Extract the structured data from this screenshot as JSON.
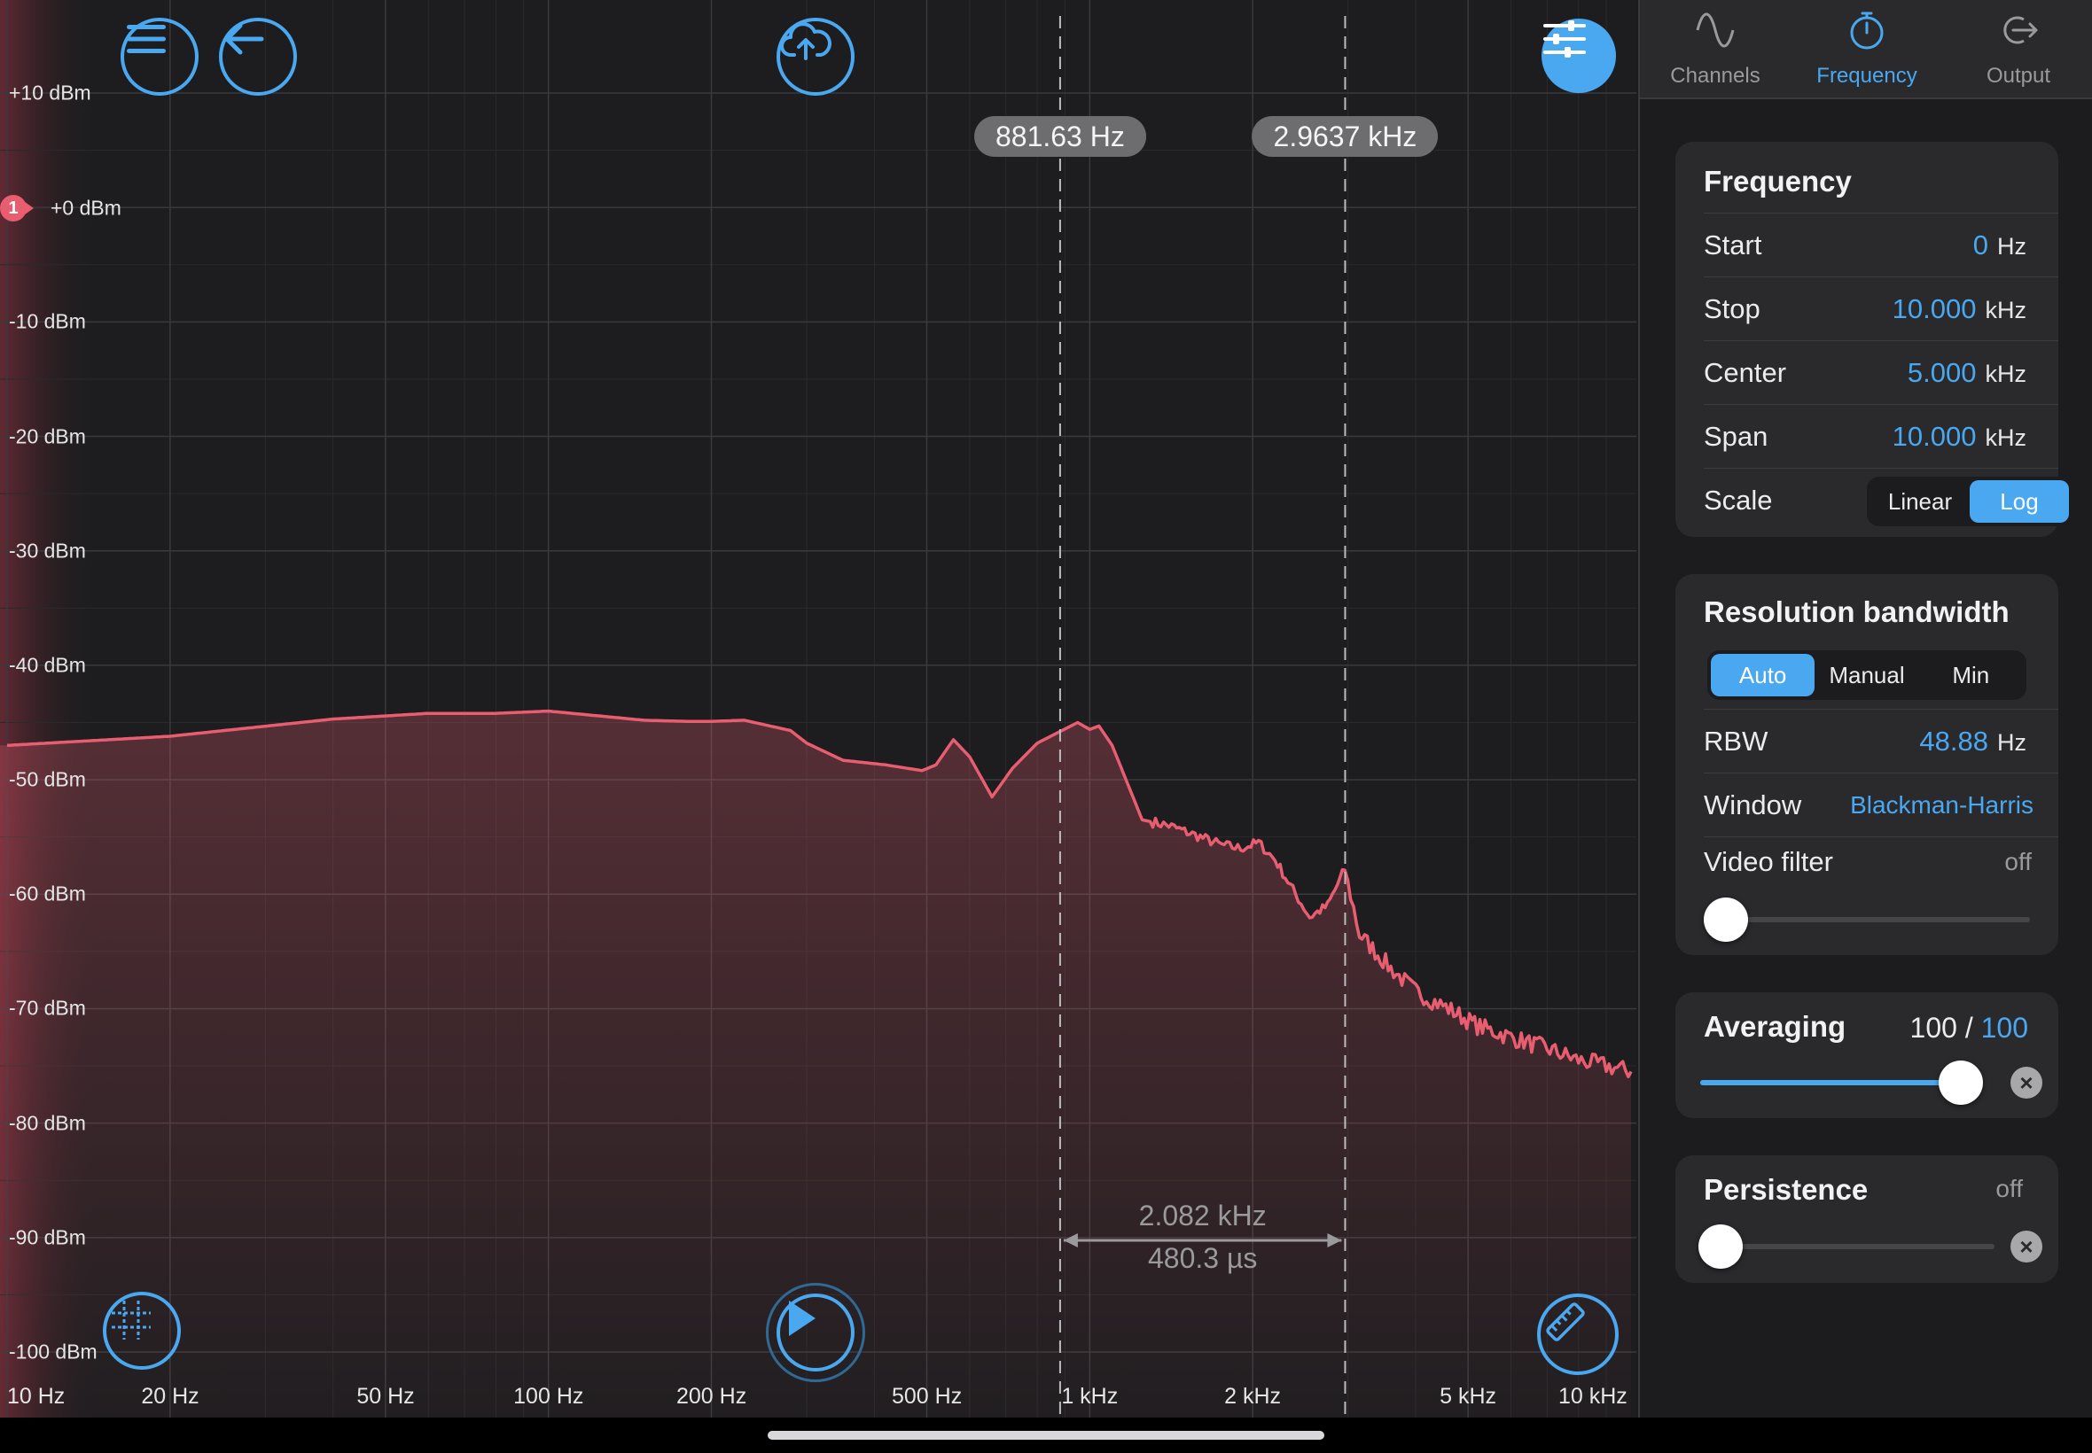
{
  "chart_data": {
    "type": "line",
    "title": "",
    "xlabel": "",
    "ylabel": "",
    "x_scale": "log",
    "xlim": [
      10,
      10000
    ],
    "ylim": [
      -100,
      10
    ],
    "grid": true,
    "x_ticks": [
      "10 Hz",
      "20 Hz",
      "50 Hz",
      "100 Hz",
      "200 Hz",
      "500 Hz",
      "1 kHz",
      "2 kHz",
      "5 kHz",
      "10 kHz"
    ],
    "y_ticks": [
      "+10 dBm",
      "+0 dBm",
      "-10 dBm",
      "-20 dBm",
      "-30 dBm",
      "-40 dBm",
      "-50 dBm",
      "-60 dBm",
      "-70 dBm",
      "-80 dBm",
      "-90 dBm",
      "-100 dBm"
    ],
    "series": [
      {
        "color": "#e85d70",
        "x": [
          10,
          20,
          40,
          60,
          80,
          100,
          150,
          180,
          200,
          230,
          280,
          300,
          350,
          420,
          460,
          490,
          520,
          560,
          600,
          660,
          720,
          800,
          880,
          950,
          1000,
          1040,
          1100,
          1250,
          1400,
          1600,
          1750,
          1900,
          2050,
          2200,
          2400,
          2550,
          2750,
          2960,
          3150,
          3600,
          4000,
          4600,
          5200,
          6000,
          7000,
          8000,
          9000,
          10000
        ],
        "y": [
          -47.0,
          -46.2,
          -44.7,
          -44.2,
          -44.2,
          -44.0,
          -44.8,
          -44.9,
          -44.9,
          -44.8,
          -45.7,
          -46.8,
          -48.3,
          -48.7,
          -49.0,
          -49.2,
          -48.7,
          -46.5,
          -48.0,
          -51.5,
          -49.0,
          -46.8,
          -45.8,
          -45.0,
          -45.6,
          -45.3,
          -47.0,
          -53.5,
          -54.0,
          -55.0,
          -55.7,
          -56.0,
          -55.5,
          -57.0,
          -60.0,
          -62.0,
          -61.0,
          -57.8,
          -63.5,
          -66.5,
          -68.5,
          -70.0,
          -71.5,
          -72.5,
          -73.5,
          -74.5,
          -75.0,
          -75.5
        ]
      }
    ],
    "reference_level": {
      "marker": "1",
      "label": "+0 dBm"
    },
    "cursors": [
      {
        "x": 881.63,
        "label": "881.63 Hz"
      },
      {
        "x": 2963.7,
        "label": "2.9637 kHz"
      }
    ],
    "delta": {
      "frequency": "2.082 kHz",
      "time": "480.3 µs"
    }
  },
  "toolbar": {
    "menu_icon": "hamburger-menu-icon",
    "back_icon": "back-arrow-icon",
    "upload_icon": "cloud-upload-icon",
    "settings_icon": "sliders-icon",
    "grid_icon": "crosshair-grid-icon",
    "play_icon": "play-icon",
    "measure_icon": "ruler-icon"
  },
  "tabs": [
    {
      "label": "Channels",
      "icon": "sine-wave-icon",
      "active": false
    },
    {
      "label": "Frequency",
      "icon": "stopwatch-icon",
      "active": true
    },
    {
      "label": "Output",
      "icon": "output-icon",
      "active": false
    }
  ],
  "frequency_card": {
    "title": "Frequency",
    "rows": [
      {
        "label": "Start",
        "value": "0",
        "unit": "Hz"
      },
      {
        "label": "Stop",
        "value": "10.000",
        "unit": "kHz"
      },
      {
        "label": "Center",
        "value": "5.000",
        "unit": "kHz"
      },
      {
        "label": "Span",
        "value": "10.000",
        "unit": "kHz"
      }
    ],
    "scale_label": "Scale",
    "scale_options": [
      "Linear",
      "Log"
    ],
    "scale_selected": "Log"
  },
  "rbw_card": {
    "title": "Resolution bandwidth",
    "modes": [
      "Auto",
      "Manual",
      "Min"
    ],
    "mode_selected": "Auto",
    "rbw_label": "RBW",
    "rbw_value": "48.88",
    "rbw_unit": "Hz",
    "window_label": "Window",
    "window_value": "Blackman-Harris",
    "video_filter_label": "Video filter",
    "video_filter_value": "off",
    "video_filter_level": 0
  },
  "averaging_card": {
    "title": "Averaging",
    "current": "100",
    "separator": " / ",
    "max": "100",
    "level": 1.0
  },
  "persistence_card": {
    "title": "Persistence",
    "value": "off",
    "level": 0
  },
  "colors": {
    "accent": "#4aa8f0",
    "trace": "#e85d70",
    "background": "#1d1d1f",
    "panel": "#2a2a2c"
  }
}
